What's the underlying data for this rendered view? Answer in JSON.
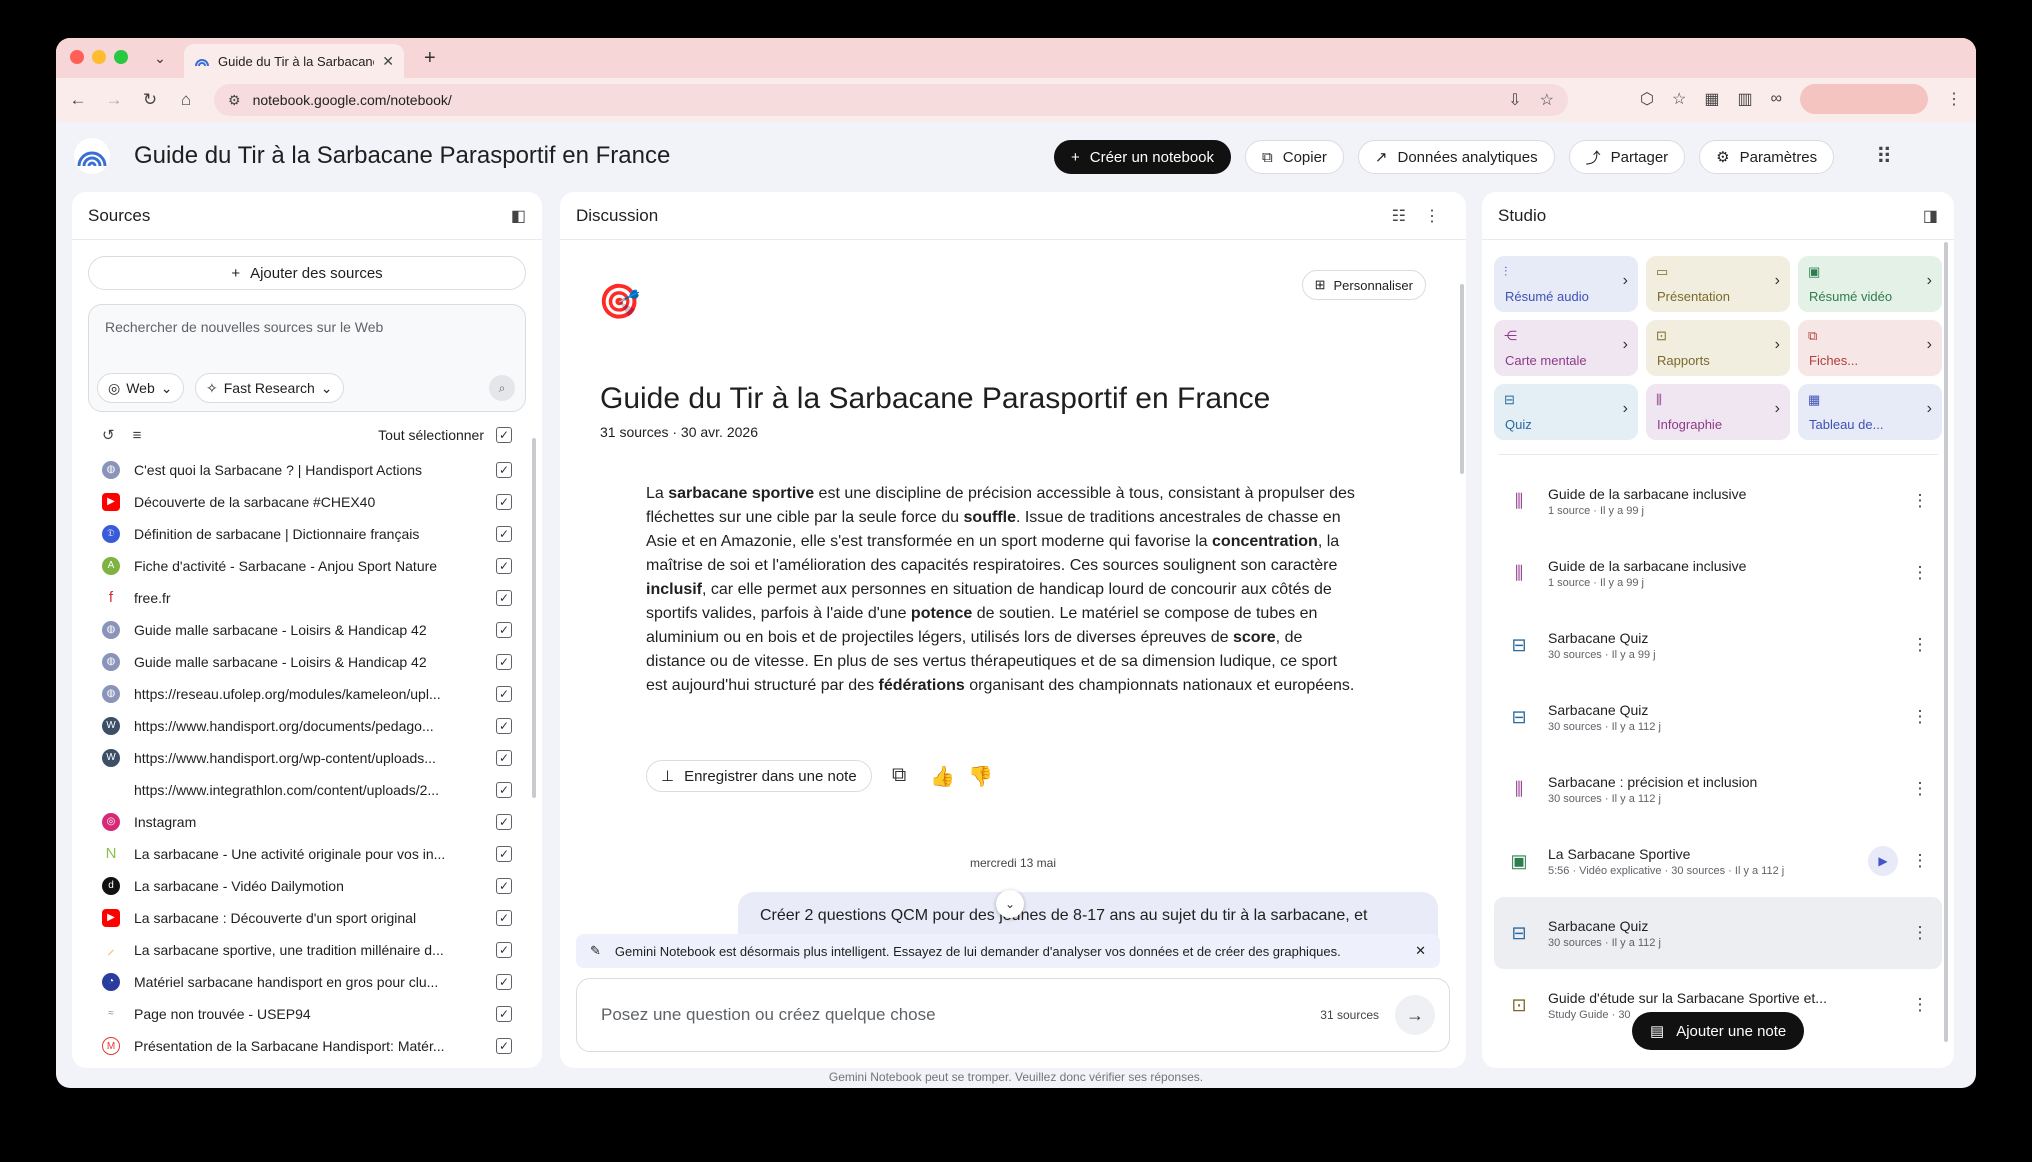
{
  "browser": {
    "tab_title": "Guide du Tir à la Sarbacane P",
    "url": "notebook.google.com/notebook/"
  },
  "header": {
    "title": "Guide du Tir à la Sarbacane Parasportif en France",
    "create_label": "Créer un notebook",
    "copy_label": "Copier",
    "analytics_label": "Données analytiques",
    "share_label": "Partager",
    "settings_label": "Paramètres"
  },
  "sources": {
    "title": "Sources",
    "add_label": "Ajouter des sources",
    "search_placeholder": "Rechercher de nouvelles sources sur le Web",
    "web_chip": "Web",
    "research_chip": "Fast Research",
    "select_all": "Tout sélectionner",
    "items": [
      {
        "name": "C'est quoi la Sarbacane ? | Handisport Actions",
        "icon": "globe",
        "color": "#8a94b8"
      },
      {
        "name": "Découverte de la sarbacane #CHEX40",
        "icon": "youtube",
        "color": "#ff0000"
      },
      {
        "name": "Définition de sarbacane | Dictionnaire français",
        "icon": "dict",
        "color": "#3a5bd9"
      },
      {
        "name": "Fiche d'activité - Sarbacane - Anjou Sport Nature",
        "icon": "asn",
        "color": "#7cb342"
      },
      {
        "name": "free.fr",
        "icon": "free",
        "color": "#d32f2f"
      },
      {
        "name": "Guide malle sarbacane - Loisirs & Handicap 42",
        "icon": "globe",
        "color": "#8a94b8"
      },
      {
        "name": "Guide malle sarbacane - Loisirs & Handicap 42",
        "icon": "globe",
        "color": "#8a94b8"
      },
      {
        "name": "https://reseau.ufolep.org/modules/kameleon/upl...",
        "icon": "globe",
        "color": "#8a94b8"
      },
      {
        "name": "https://www.handisport.org/documents/pedago...",
        "icon": "wordpress",
        "color": "#3c4f66"
      },
      {
        "name": "https://www.handisport.org/wp-content/uploads...",
        "icon": "wordpress",
        "color": "#3c4f66"
      },
      {
        "name": "https://www.integrathlon.com/content/uploads/2...",
        "icon": "blank",
        "color": "#ffffff"
      },
      {
        "name": "Instagram",
        "icon": "instagram",
        "color": "#d62976"
      },
      {
        "name": "La sarbacane - Une activité originale pour vos in...",
        "icon": "leaf",
        "color": "#8bc34a"
      },
      {
        "name": "La sarbacane - Vidéo Dailymotion",
        "icon": "dailymotion",
        "color": "#111111"
      },
      {
        "name": "La sarbacane : Découverte d'un sport original",
        "icon": "youtube",
        "color": "#ff0000"
      },
      {
        "name": "La sarbacane sportive, une tradition millénaire d...",
        "icon": "feather",
        "color": "#f9a825"
      },
      {
        "name": "Matériel sarbacane handisport en gros pour clu...",
        "icon": "brand",
        "color": "#2a3d9e"
      },
      {
        "name": "Page non trouvée - USEP94",
        "icon": "usep",
        "color": "#b0bec5"
      },
      {
        "name": "Présentation de la Sarbacane Handisport: Matér...",
        "icon": "mj",
        "color": "#e53935"
      }
    ]
  },
  "discussion": {
    "title": "Discussion",
    "personalize": "Personnaliser",
    "emoji": "🎯",
    "doc_title": "Guide du Tir à la Sarbacane Parasportif en France",
    "doc_sub": "31 sources · 30 avr. 2026",
    "save_note": "Enregistrer dans une note",
    "day_label": "mercredi 13 mai",
    "user_message": "Créer 2 questions QCM pour des jeunes de 8-17 ans au sujet du tir à la sarbacane, et",
    "banner": "Gemini Notebook est désormais plus intelligent. Essayez de lui demander d'analyser vos données et de créer des graphiques.",
    "ask_placeholder": "Posez une question ou créez quelque chose",
    "ask_count": "31 sources"
  },
  "studio": {
    "title": "Studio",
    "tiles": [
      {
        "label": "Résumé audio",
        "icon": "audio",
        "bg": "#e7ebf7",
        "fg": "#3f51b5"
      },
      {
        "label": "Présentation",
        "icon": "slides",
        "bg": "#f2eedf",
        "fg": "#7a6a2a"
      },
      {
        "label": "Résumé vidéo",
        "icon": "video",
        "bg": "#e3f1e6",
        "fg": "#2e7d4f"
      },
      {
        "label": "Carte mentale",
        "icon": "mindmap",
        "bg": "#f0e6f1",
        "fg": "#8e3a8a"
      },
      {
        "label": "Rapports",
        "icon": "report",
        "bg": "#f2eedf",
        "fg": "#7a6a2a"
      },
      {
        "label": "Fiches...",
        "icon": "cards",
        "bg": "#f6e7e6",
        "fg": "#b23c3c"
      },
      {
        "label": "Quiz",
        "icon": "quiz",
        "bg": "#e3eef5",
        "fg": "#2a6a9e"
      },
      {
        "label": "Infographie",
        "icon": "infographic",
        "bg": "#f0e6f1",
        "fg": "#8e3a8a"
      },
      {
        "label": "Tableau de...",
        "icon": "table",
        "bg": "#e7ebf7",
        "fg": "#3f51b5"
      }
    ],
    "notes": [
      {
        "title": "Guide de la sarbacane inclusive",
        "meta": "1 source · Il y a 99 j",
        "icon": "infographic"
      },
      {
        "title": "Guide de la sarbacane inclusive",
        "meta": "1 source · Il y a 99 j",
        "icon": "infographic"
      },
      {
        "title": "Sarbacane Quiz",
        "meta": "30 sources · Il y a 99 j",
        "icon": "quiz"
      },
      {
        "title": "Sarbacane Quiz",
        "meta": "30 sources · Il y a 112 j",
        "icon": "quiz"
      },
      {
        "title": "Sarbacane : précision et inclusion",
        "meta": "30 sources · Il y a 112 j",
        "icon": "infographic"
      },
      {
        "title": "La Sarbacane Sportive",
        "meta": "5:56 · Vidéo explicative · 30 sources · Il y a 112 j",
        "icon": "video"
      },
      {
        "title": "Sarbacane Quiz",
        "meta": "30 sources · Il y a 112 j",
        "icon": "quiz"
      },
      {
        "title": "Guide d'étude sur la Sarbacane Sportive et...",
        "meta": "Study Guide · 30",
        "icon": "report"
      }
    ],
    "add_note": "Ajouter une note"
  },
  "footer": "Gemini Notebook peut se tromper. Veuillez donc vérifier ses réponses."
}
